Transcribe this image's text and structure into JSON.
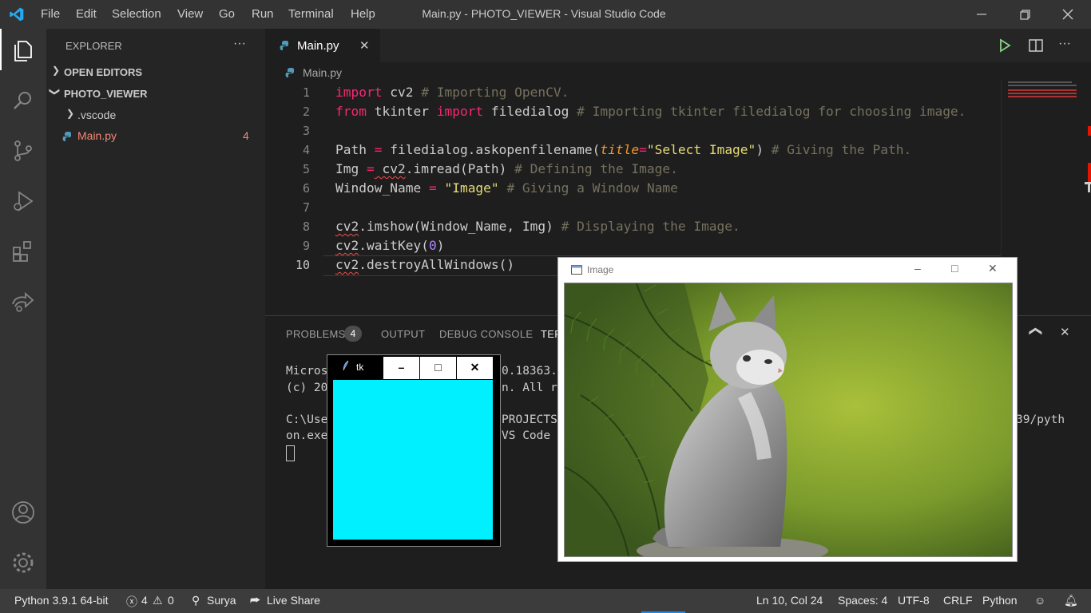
{
  "menu": [
    "File",
    "Edit",
    "Selection",
    "View",
    "Go",
    "Run",
    "Terminal",
    "Help"
  ],
  "window_title": "Main.py - PHOTO_VIEWER - Visual Studio Code",
  "explorer": {
    "header": "EXPLORER",
    "more": "···",
    "open_editors": "OPEN EDITORS",
    "folder": "PHOTO_VIEWER",
    "items": [
      {
        "name": ".vscode"
      },
      {
        "name": "Main.py",
        "badge": "4"
      }
    ]
  },
  "tab": {
    "label": "Main.py",
    "close": "✕"
  },
  "breadcrumb": "Main.py",
  "line_numbers": [
    "1",
    "2",
    "3",
    "4",
    "5",
    "6",
    "7",
    "8",
    "9",
    "10"
  ],
  "code": {
    "l1": {
      "kw": "import",
      "mod": " cv2 ",
      "cm": "# Importing OpenCV."
    },
    "l2": {
      "kw1": "from",
      "mod1": " tkinter ",
      "kw2": "import",
      "mod2": " filedialog ",
      "cm": "# Importing tkinter filedialog for choosing image."
    },
    "l4": {
      "a": "Path ",
      "op": "=",
      "b": " filedialog.askopenfilename(",
      "param": "title",
      "eq": "=",
      "str": "\"Select Image\"",
      "c": ") ",
      "cm": "# Giving the Path."
    },
    "l5": {
      "a": "Img ",
      "op": "=",
      "sq": " cv2",
      "b": ".imread(Path) ",
      "cm": "# Defining the Image."
    },
    "l6": {
      "a": "Window_Name ",
      "op": "=",
      "sp": " ",
      "str": "\"Image\"",
      "b": " ",
      "cm": "# Giving a Window Name"
    },
    "l8": {
      "sq": "cv2",
      "b": ".imshow(Window_Name, Img) ",
      "cm": "# Displaying the Image."
    },
    "l9": {
      "sq": "cv2",
      "b": ".waitKey(",
      "num": "0",
      "c": ")"
    },
    "l10": {
      "sq": "cv2",
      "b": ".destroyAllWindows()"
    }
  },
  "panel": {
    "tabs": [
      "PROBLEMS",
      "OUTPUT",
      "DEBUG CONSOLE",
      "TERI"
    ],
    "problems_count": "4",
    "terminal": {
      "l1a": "Micros",
      "l1b": "0.18363.",
      "l2a": "(c) 20",
      "l2b": "n. All ri",
      "l3a": "C:\\Use",
      "l3b": "PROJECTS",
      "l3c": "39/pyth",
      "l4a": "on.exe",
      "l4b": "VS Code"
    }
  },
  "tk_window": {
    "title": "tk",
    "min": "–",
    "max": "□",
    "close": "✕",
    "canvas_color": "#00f0ff"
  },
  "image_window": {
    "title": "Image",
    "min": "–",
    "max": "□",
    "close": "✕"
  },
  "status": {
    "python": "Python 3.9.1 64-bit",
    "errors": "4",
    "warnings": "0",
    "ports": "0",
    "user": "Surya",
    "live_share": "Live Share",
    "position": "Ln 10, Col 24",
    "spaces": "Spaces: 4",
    "encoding": "UTF-8",
    "eol": "CRLF",
    "language": "Python"
  },
  "colors": {
    "accent": "#007acc",
    "keyword": "#f92672",
    "string": "#e6db74",
    "comment": "#75715e",
    "error": "#f14c4c"
  }
}
